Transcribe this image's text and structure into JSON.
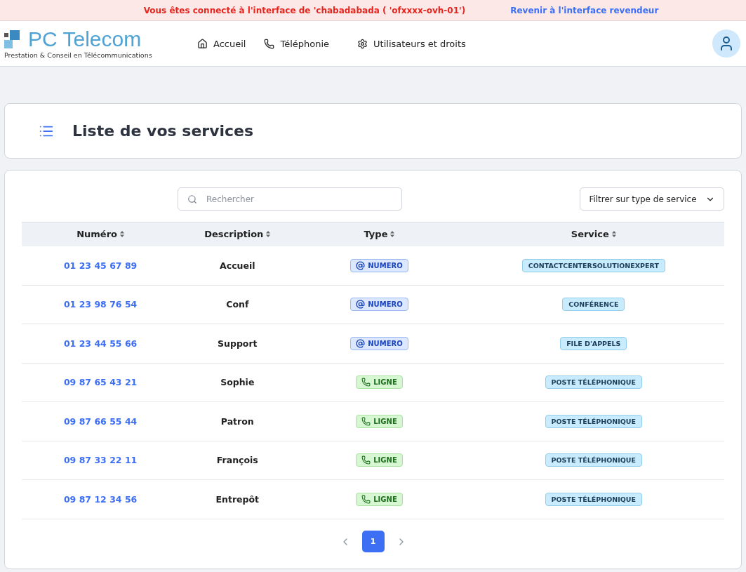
{
  "banner": {
    "message": "Vous êtes connecté à l'interface de 'chabadabada ( 'ofxxxx-ovh-01')",
    "link": "Revenir à l'interface revendeur"
  },
  "logo": {
    "name": "PC Telecom",
    "tagline": "Prestation & Conseil en Télécommunications"
  },
  "nav": [
    {
      "label": "Accueil"
    },
    {
      "label": "Téléphonie"
    },
    {
      "label": "Utilisateurs et droits"
    }
  ],
  "page_title": "Liste de vos services",
  "search": {
    "placeholder": "Rechercher"
  },
  "filter": {
    "label": "Filtrer sur type de service"
  },
  "table": {
    "columns": [
      "Numéro",
      "Description",
      "Type",
      "Service"
    ],
    "rows": [
      {
        "number": "01 23 45 67 89",
        "description": "Accueil",
        "type": {
          "kind": "numero",
          "label": "NUMERO"
        },
        "service": "CONTACTCENTERSOLUTIONEXPERT"
      },
      {
        "number": "01 23 98 76 54",
        "description": "Conf",
        "type": {
          "kind": "numero",
          "label": "NUMERO"
        },
        "service": "CONFÉRENCE"
      },
      {
        "number": "01 23 44 55 66",
        "description": "Support",
        "type": {
          "kind": "numero",
          "label": "NUMERO"
        },
        "service": "FILE D'APPELS"
      },
      {
        "number": "09 87 65 43 21",
        "description": "Sophie",
        "type": {
          "kind": "ligne",
          "label": "LIGNE"
        },
        "service": "POSTE TÉLÉPHONIQUE"
      },
      {
        "number": "09 87 66 55 44",
        "description": "Patron",
        "type": {
          "kind": "ligne",
          "label": "LIGNE"
        },
        "service": "POSTE TÉLÉPHONIQUE"
      },
      {
        "number": "09 87 33 22 11",
        "description": "François",
        "type": {
          "kind": "ligne",
          "label": "LIGNE"
        },
        "service": "POSTE TÉLÉPHONIQUE"
      },
      {
        "number": "09 87 12 34 56",
        "description": "Entrepôt",
        "type": {
          "kind": "ligne",
          "label": "LIGNE"
        },
        "service": "POSTE TÉLÉPHONIQUE"
      }
    ]
  },
  "pagination": [
    {
      "label": "1",
      "selected": true
    }
  ]
}
